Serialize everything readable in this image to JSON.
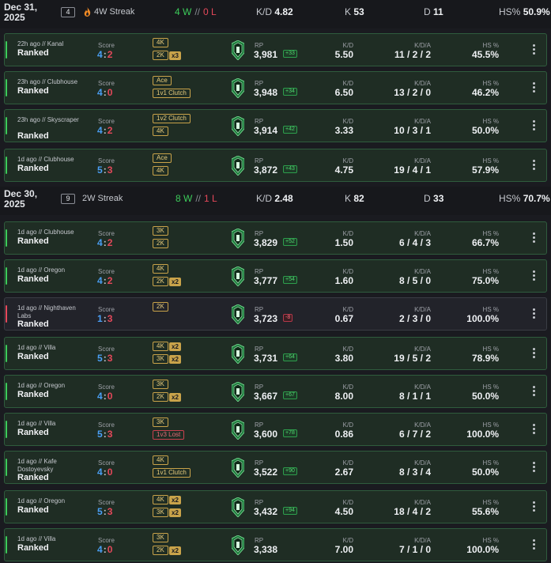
{
  "columns": {
    "score": "Score",
    "rp": "RP",
    "kd": "K/D",
    "kda": "K/D/A",
    "hs": "HS %"
  },
  "colors": {
    "win": "#3ccb5a",
    "loss": "#e5485a",
    "team_score": "#4a9ff5",
    "tag_gold": "#c9a34a",
    "card_bg": "#1f2d24"
  },
  "days": [
    {
      "date": "Dec 31, 2025",
      "matches_count": "4",
      "streak_icon": "flame-icon",
      "streak": "4W Streak",
      "wins": "4 W",
      "sep": "//",
      "losses": "0 L",
      "kd_label": "K/D",
      "kd": "4.82",
      "k_label": "K",
      "k": "53",
      "d_label": "D",
      "d": "11",
      "hs_label": "HS%",
      "hs": "50.9%",
      "matches": [
        {
          "ago": "22h ago // Kanal",
          "mode": "Ranked",
          "score_a": "4",
          "score_b": "2",
          "tags": [
            {
              "label": "4K"
            },
            {
              "label": "2K",
              "mult": "x3"
            }
          ],
          "rank_icon": "rank-emblem-icon",
          "rp": "3,981",
          "delta": "+33",
          "kd": "5.50",
          "kda": "11 / 2 / 2",
          "hs": "45.5%",
          "result": "win"
        },
        {
          "ago": "23h ago // Clubhouse",
          "mode": "Ranked",
          "score_a": "4",
          "score_b": "0",
          "tags": [
            {
              "label": "Ace"
            },
            {
              "label": "1v1 Clutch"
            }
          ],
          "rank_icon": "rank-emblem-icon",
          "rp": "3,948",
          "delta": "+34",
          "kd": "6.50",
          "kda": "13 / 2 / 0",
          "hs": "46.2%",
          "result": "win"
        },
        {
          "ago": "23h ago // Skyscraper",
          "mode": "Ranked",
          "score_a": "4",
          "score_b": "2",
          "tags": [
            {
              "label": "1v2 Clutch"
            },
            {
              "label": "4K"
            }
          ],
          "rank_icon": "rank-emblem-icon",
          "rp": "3,914",
          "delta": "+42",
          "kd": "3.33",
          "kda": "10 / 3 / 1",
          "hs": "50.0%",
          "result": "win"
        },
        {
          "ago": "1d ago // Clubhouse",
          "mode": "Ranked",
          "score_a": "5",
          "score_b": "3",
          "tags": [
            {
              "label": "Ace"
            },
            {
              "label": "4K"
            }
          ],
          "rank_icon": "rank-emblem-icon",
          "rp": "3,872",
          "delta": "+43",
          "kd": "4.75",
          "kda": "19 / 4 / 1",
          "hs": "57.9%",
          "result": "win"
        }
      ]
    },
    {
      "date": "Dec 30, 2025",
      "matches_count": "9",
      "streak_icon": "",
      "streak": "2W Streak",
      "wins": "8 W",
      "sep": "//",
      "losses": "1 L",
      "kd_label": "K/D",
      "kd": "2.48",
      "k_label": "K",
      "k": "82",
      "d_label": "D",
      "d": "33",
      "hs_label": "HS%",
      "hs": "70.7%",
      "matches": [
        {
          "ago": "1d ago // Clubhouse",
          "mode": "Ranked",
          "score_a": "4",
          "score_b": "2",
          "tags": [
            {
              "label": "3K"
            },
            {
              "label": "2K"
            }
          ],
          "rank_icon": "rank-emblem-icon",
          "rp": "3,829",
          "delta": "+52",
          "kd": "1.50",
          "kda": "6 / 4 / 3",
          "hs": "66.7%",
          "result": "win"
        },
        {
          "ago": "1d ago // Oregon",
          "mode": "Ranked",
          "score_a": "4",
          "score_b": "2",
          "tags": [
            {
              "label": "4K"
            },
            {
              "label": "2K",
              "mult": "x2"
            }
          ],
          "rank_icon": "rank-emblem-icon",
          "rp": "3,777",
          "delta": "+54",
          "kd": "1.60",
          "kda": "8 / 5 / 0",
          "hs": "75.0%",
          "result": "win"
        },
        {
          "ago": "1d ago // Nighthaven Labs",
          "mode": "Ranked",
          "score_a": "1",
          "score_b": "3",
          "tags": [
            {
              "label": "2K"
            }
          ],
          "rank_icon": "rank-emblem-icon",
          "rp": "3,723",
          "delta": "-8",
          "kd": "0.67",
          "kda": "2 / 3 / 0",
          "hs": "100.0%",
          "result": "loss"
        },
        {
          "ago": "1d ago // Villa",
          "mode": "Ranked",
          "score_a": "5",
          "score_b": "3",
          "tags": [
            {
              "label": "4K",
              "mult": "x2"
            },
            {
              "label": "3K",
              "mult": "x2"
            }
          ],
          "rank_icon": "rank-emblem-icon",
          "rp": "3,731",
          "delta": "+64",
          "kd": "3.80",
          "kda": "19 / 5 / 2",
          "hs": "78.9%",
          "result": "win"
        },
        {
          "ago": "1d ago // Oregon",
          "mode": "Ranked",
          "score_a": "4",
          "score_b": "0",
          "tags": [
            {
              "label": "3K"
            },
            {
              "label": "2K",
              "mult": "x2"
            }
          ],
          "rank_icon": "rank-emblem-icon",
          "rp": "3,667",
          "delta": "+67",
          "kd": "8.00",
          "kda": "8 / 1 / 1",
          "hs": "50.0%",
          "result": "win"
        },
        {
          "ago": "1d ago // Villa",
          "mode": "Ranked",
          "score_a": "5",
          "score_b": "3",
          "tags": [
            {
              "label": "3K"
            },
            {
              "label": "1v3 Lost",
              "bad": true
            }
          ],
          "rank_icon": "rank-emblem-icon",
          "rp": "3,600",
          "delta": "+78",
          "kd": "0.86",
          "kda": "6 / 7 / 2",
          "hs": "100.0%",
          "result": "win"
        },
        {
          "ago": "1d ago // Kafe Dostoyevsky",
          "mode": "Ranked",
          "score_a": "4",
          "score_b": "0",
          "tags": [
            {
              "label": "4K"
            },
            {
              "label": "1v1 Clutch"
            }
          ],
          "rank_icon": "rank-emblem-icon",
          "rp": "3,522",
          "delta": "+90",
          "kd": "2.67",
          "kda": "8 / 3 / 4",
          "hs": "50.0%",
          "result": "win"
        },
        {
          "ago": "1d ago // Oregon",
          "mode": "Ranked",
          "score_a": "5",
          "score_b": "3",
          "tags": [
            {
              "label": "4K",
              "mult": "x2"
            },
            {
              "label": "3K",
              "mult": "x2"
            }
          ],
          "rank_icon": "rank-emblem-icon",
          "rp": "3,432",
          "delta": "+94",
          "kd": "4.50",
          "kda": "18 / 4 / 2",
          "hs": "55.6%",
          "result": "win"
        },
        {
          "ago": "1d ago // Villa",
          "mode": "Ranked",
          "score_a": "4",
          "score_b": "0",
          "tags": [
            {
              "label": "3K"
            },
            {
              "label": "2K",
              "mult": "x2"
            }
          ],
          "rank_icon": "rank-emblem-icon",
          "rp": "3,338",
          "delta": "",
          "kd": "7.00",
          "kda": "7 / 1 / 0",
          "hs": "100.0%",
          "result": "win"
        }
      ]
    }
  ]
}
